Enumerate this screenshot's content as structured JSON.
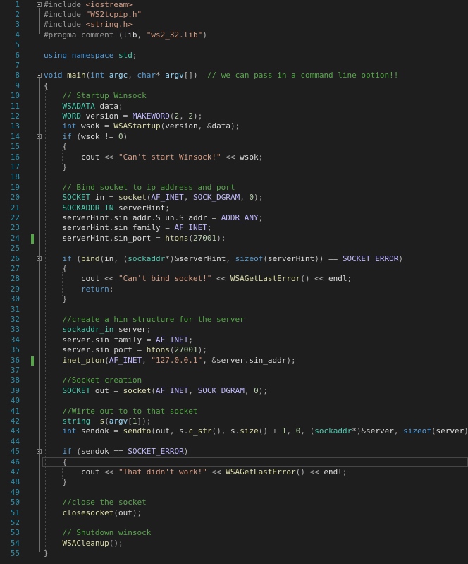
{
  "editor": {
    "lines": [
      {
        "n": "1",
        "t": [
          [
            "pp",
            "#include "
          ],
          [
            "inc",
            "<iostream>"
          ]
        ]
      },
      {
        "n": "2",
        "t": [
          [
            "pp",
            "#include "
          ],
          [
            "inc",
            "\"WS2tcpip.h\""
          ]
        ]
      },
      {
        "n": "3",
        "t": [
          [
            "pp",
            "#include "
          ],
          [
            "inc",
            "<string.h>"
          ]
        ]
      },
      {
        "n": "4",
        "t": [
          [
            "pp",
            "#pragma "
          ],
          [
            "pp",
            "comment "
          ],
          [
            "op",
            "("
          ],
          [
            "var",
            "lib"
          ],
          [
            "op",
            ", "
          ],
          [
            "str",
            "\"ws2_32.lib\""
          ],
          [
            "op",
            ")"
          ]
        ]
      },
      {
        "n": "5",
        "t": []
      },
      {
        "n": "6",
        "t": [
          [
            "kw",
            "using namespace "
          ],
          [
            "ty",
            "std"
          ],
          [
            "op",
            ";"
          ]
        ]
      },
      {
        "n": "7",
        "t": []
      },
      {
        "n": "8",
        "t": [
          [
            "kw",
            "void "
          ],
          [
            "fn",
            "main"
          ],
          [
            "op",
            "("
          ],
          [
            "kw",
            "int "
          ],
          [
            "par",
            "argc"
          ],
          [
            "op",
            ", "
          ],
          [
            "kw",
            "char"
          ],
          [
            "op",
            "* "
          ],
          [
            "par",
            "argv"
          ],
          [
            "op",
            "[])  "
          ],
          [
            "com",
            "// we can pass in a command line option!!"
          ]
        ]
      },
      {
        "n": "9",
        "t": [
          [
            "op",
            "{"
          ]
        ]
      },
      {
        "n": "10",
        "t": [
          [
            "com",
            "    // Startup Winsock"
          ]
        ]
      },
      {
        "n": "11",
        "t": [
          [
            "ty",
            "    WSADATA "
          ],
          [
            "var",
            "data"
          ],
          [
            "op",
            ";"
          ]
        ]
      },
      {
        "n": "12",
        "t": [
          [
            "ty",
            "    WORD "
          ],
          [
            "var",
            "version "
          ],
          [
            "op",
            "= "
          ],
          [
            "mac",
            "MAKEWORD"
          ],
          [
            "op",
            "("
          ],
          [
            "num",
            "2"
          ],
          [
            "op",
            ", "
          ],
          [
            "num",
            "2"
          ],
          [
            "op",
            ");"
          ]
        ]
      },
      {
        "n": "13",
        "t": [
          [
            "kw",
            "    int "
          ],
          [
            "var",
            "wsok "
          ],
          [
            "op",
            "= "
          ],
          [
            "fn",
            "WSAStartup"
          ],
          [
            "op",
            "("
          ],
          [
            "var",
            "version"
          ],
          [
            "op",
            ", &"
          ],
          [
            "var",
            "data"
          ],
          [
            "op",
            ");"
          ]
        ]
      },
      {
        "n": "14",
        "t": [
          [
            "kw",
            "    if "
          ],
          [
            "op",
            "("
          ],
          [
            "var",
            "wsok "
          ],
          [
            "op",
            "!= "
          ],
          [
            "num",
            "0"
          ],
          [
            "op",
            ")"
          ]
        ]
      },
      {
        "n": "15",
        "t": [
          [
            "op",
            "    {"
          ]
        ]
      },
      {
        "n": "16",
        "t": [
          [
            "var",
            "        cout "
          ],
          [
            "op",
            "<< "
          ],
          [
            "str",
            "\"Can't start Winsock!\" "
          ],
          [
            "op",
            "<< "
          ],
          [
            "var",
            "wsok"
          ],
          [
            "op",
            ";"
          ]
        ]
      },
      {
        "n": "17",
        "t": [
          [
            "op",
            "    }"
          ]
        ]
      },
      {
        "n": "18",
        "t": []
      },
      {
        "n": "19",
        "t": [
          [
            "com",
            "    // Bind socket to ip address and port"
          ]
        ]
      },
      {
        "n": "20",
        "t": [
          [
            "ty",
            "    SOCKET "
          ],
          [
            "var",
            "in "
          ],
          [
            "op",
            "= "
          ],
          [
            "fn",
            "socket"
          ],
          [
            "op",
            "("
          ],
          [
            "mac",
            "AF_INET"
          ],
          [
            "op",
            ", "
          ],
          [
            "mac",
            "SOCK_DGRAM"
          ],
          [
            "op",
            ", "
          ],
          [
            "num",
            "0"
          ],
          [
            "op",
            ");"
          ]
        ]
      },
      {
        "n": "21",
        "t": [
          [
            "ty",
            "    SOCKADDR_IN "
          ],
          [
            "var",
            "serverHint"
          ],
          [
            "op",
            ";"
          ]
        ]
      },
      {
        "n": "22",
        "t": [
          [
            "var",
            "    serverHint"
          ],
          [
            "op",
            "."
          ],
          [
            "var",
            "sin_addr"
          ],
          [
            "op",
            "."
          ],
          [
            "var",
            "S_un"
          ],
          [
            "op",
            "."
          ],
          [
            "var",
            "S_addr "
          ],
          [
            "op",
            "= "
          ],
          [
            "mac",
            "ADDR_ANY"
          ],
          [
            "op",
            ";"
          ]
        ]
      },
      {
        "n": "23",
        "t": [
          [
            "var",
            "    serverHint"
          ],
          [
            "op",
            "."
          ],
          [
            "var",
            "sin_family "
          ],
          [
            "op",
            "= "
          ],
          [
            "mac",
            "AF_INET"
          ],
          [
            "op",
            ";"
          ]
        ]
      },
      {
        "n": "24",
        "t": [
          [
            "var",
            "    serverHint"
          ],
          [
            "op",
            "."
          ],
          [
            "var",
            "sin_port "
          ],
          [
            "op",
            "= "
          ],
          [
            "fn",
            "htons"
          ],
          [
            "op",
            "("
          ],
          [
            "num",
            "27001"
          ],
          [
            "op",
            ");"
          ]
        ]
      },
      {
        "n": "25",
        "t": []
      },
      {
        "n": "26",
        "t": [
          [
            "kw",
            "    if "
          ],
          [
            "op",
            "("
          ],
          [
            "fn",
            "bind"
          ],
          [
            "op",
            "("
          ],
          [
            "var",
            "in"
          ],
          [
            "op",
            ", ("
          ],
          [
            "ty",
            "sockaddr"
          ],
          [
            "op",
            "*)&"
          ],
          [
            "var",
            "serverHint"
          ],
          [
            "op",
            ", "
          ],
          [
            "kw",
            "sizeof"
          ],
          [
            "op",
            "("
          ],
          [
            "var",
            "serverHint"
          ],
          [
            "op",
            ")) == "
          ],
          [
            "mac",
            "SOCKET_ERROR"
          ],
          [
            "op",
            ")"
          ]
        ]
      },
      {
        "n": "27",
        "t": [
          [
            "op",
            "    {"
          ]
        ]
      },
      {
        "n": "28",
        "t": [
          [
            "var",
            "        cout "
          ],
          [
            "op",
            "<< "
          ],
          [
            "str",
            "\"Can't bind socket!\" "
          ],
          [
            "op",
            "<< "
          ],
          [
            "fn",
            "WSAGetLastError"
          ],
          [
            "op",
            "() << "
          ],
          [
            "var",
            "endl"
          ],
          [
            "op",
            ";"
          ]
        ]
      },
      {
        "n": "29",
        "t": [
          [
            "kw",
            "        return"
          ],
          [
            "op",
            ";"
          ]
        ]
      },
      {
        "n": "30",
        "t": [
          [
            "op",
            "    }"
          ]
        ]
      },
      {
        "n": "31",
        "t": []
      },
      {
        "n": "32",
        "t": [
          [
            "com",
            "    //create a hin structure for the server"
          ]
        ]
      },
      {
        "n": "33",
        "t": [
          [
            "ty",
            "    sockaddr_in "
          ],
          [
            "var",
            "server"
          ],
          [
            "op",
            ";"
          ]
        ]
      },
      {
        "n": "34",
        "t": [
          [
            "var",
            "    server"
          ],
          [
            "op",
            "."
          ],
          [
            "var",
            "sin_family "
          ],
          [
            "op",
            "= "
          ],
          [
            "mac",
            "AF_INET"
          ],
          [
            "op",
            ";"
          ]
        ]
      },
      {
        "n": "35",
        "t": [
          [
            "var",
            "    server"
          ],
          [
            "op",
            "."
          ],
          [
            "var",
            "sin_port "
          ],
          [
            "op",
            "= "
          ],
          [
            "fn",
            "htons"
          ],
          [
            "op",
            "("
          ],
          [
            "num",
            "27001"
          ],
          [
            "op",
            ");"
          ]
        ]
      },
      {
        "n": "36",
        "t": [
          [
            "fn",
            "    inet_pton"
          ],
          [
            "op",
            "("
          ],
          [
            "mac",
            "AF_INET"
          ],
          [
            "op",
            ", "
          ],
          [
            "str",
            "\"127.0.0.1\""
          ],
          [
            "op",
            ", &"
          ],
          [
            "var",
            "server"
          ],
          [
            "op",
            "."
          ],
          [
            "var",
            "sin_addr"
          ],
          [
            "op",
            ");"
          ]
        ]
      },
      {
        "n": "37",
        "t": []
      },
      {
        "n": "38",
        "t": [
          [
            "com",
            "    //Socket creation"
          ]
        ]
      },
      {
        "n": "39",
        "t": [
          [
            "ty",
            "    SOCKET "
          ],
          [
            "var",
            "out "
          ],
          [
            "op",
            "= "
          ],
          [
            "fn",
            "socket"
          ],
          [
            "op",
            "("
          ],
          [
            "mac",
            "AF_INET"
          ],
          [
            "op",
            ", "
          ],
          [
            "mac",
            "SOCK_DGRAM"
          ],
          [
            "op",
            ", "
          ],
          [
            "num",
            "0"
          ],
          [
            "op",
            ");"
          ]
        ]
      },
      {
        "n": "40",
        "t": []
      },
      {
        "n": "41",
        "t": [
          [
            "com",
            "    //Wirte out to to that socket"
          ]
        ]
      },
      {
        "n": "42",
        "t": [
          [
            "ty",
            "    string  "
          ],
          [
            "fn",
            "s"
          ],
          [
            "op",
            "("
          ],
          [
            "par",
            "argv"
          ],
          [
            "op",
            "["
          ],
          [
            "num",
            "1"
          ],
          [
            "op",
            "]);"
          ]
        ]
      },
      {
        "n": "43",
        "t": [
          [
            "kw",
            "    int "
          ],
          [
            "var",
            "sendok "
          ],
          [
            "op",
            "= "
          ],
          [
            "fn",
            "sendto"
          ],
          [
            "op",
            "("
          ],
          [
            "var",
            "out"
          ],
          [
            "op",
            ", "
          ],
          [
            "var",
            "s"
          ],
          [
            "op",
            "."
          ],
          [
            "fn",
            "c_str"
          ],
          [
            "op",
            "(), "
          ],
          [
            "var",
            "s"
          ],
          [
            "op",
            "."
          ],
          [
            "fn",
            "size"
          ],
          [
            "op",
            "() + "
          ],
          [
            "num",
            "1"
          ],
          [
            "op",
            ", "
          ],
          [
            "num",
            "0"
          ],
          [
            "op",
            ", ("
          ],
          [
            "ty",
            "sockaddr"
          ],
          [
            "op",
            "*)&"
          ],
          [
            "var",
            "server"
          ],
          [
            "op",
            ", "
          ],
          [
            "kw",
            "sizeof"
          ],
          [
            "op",
            "("
          ],
          [
            "var",
            "server"
          ],
          [
            "op",
            "));"
          ]
        ]
      },
      {
        "n": "44",
        "t": []
      },
      {
        "n": "45",
        "t": [
          [
            "kw",
            "    if "
          ],
          [
            "op",
            "("
          ],
          [
            "var",
            "sendok "
          ],
          [
            "op",
            "== "
          ],
          [
            "mac",
            "SOCKET_ERROR"
          ],
          [
            "op",
            ")"
          ]
        ]
      },
      {
        "n": "46",
        "t": [
          [
            "op",
            "    {"
          ]
        ]
      },
      {
        "n": "47",
        "t": [
          [
            "var",
            "        cout "
          ],
          [
            "op",
            "<< "
          ],
          [
            "str",
            "\"That didn't work!\" "
          ],
          [
            "op",
            "<< "
          ],
          [
            "fn",
            "WSAGetLastError"
          ],
          [
            "op",
            "() << "
          ],
          [
            "var",
            "endl"
          ],
          [
            "op",
            ";"
          ]
        ]
      },
      {
        "n": "48",
        "t": [
          [
            "op",
            "    }"
          ]
        ]
      },
      {
        "n": "49",
        "t": []
      },
      {
        "n": "50",
        "t": [
          [
            "com",
            "    //close the socket"
          ]
        ]
      },
      {
        "n": "51",
        "t": [
          [
            "fn",
            "    closesocket"
          ],
          [
            "op",
            "("
          ],
          [
            "var",
            "out"
          ],
          [
            "op",
            ");"
          ]
        ]
      },
      {
        "n": "52",
        "t": []
      },
      {
        "n": "53",
        "t": [
          [
            "com",
            "    // Shutdown winsock"
          ]
        ]
      },
      {
        "n": "54",
        "t": [
          [
            "fn",
            "    WSACleanup"
          ],
          [
            "op",
            "();"
          ]
        ]
      },
      {
        "n": "55",
        "t": [
          [
            "op",
            "}"
          ]
        ]
      }
    ],
    "changed_lines": [
      24,
      36
    ],
    "fold_lines": [
      1,
      8,
      14,
      26,
      45
    ],
    "current_line": 46,
    "colors": {
      "background": "#1e1e1e",
      "line_number": "#2b91af",
      "change_marker": "#57a64a"
    }
  }
}
